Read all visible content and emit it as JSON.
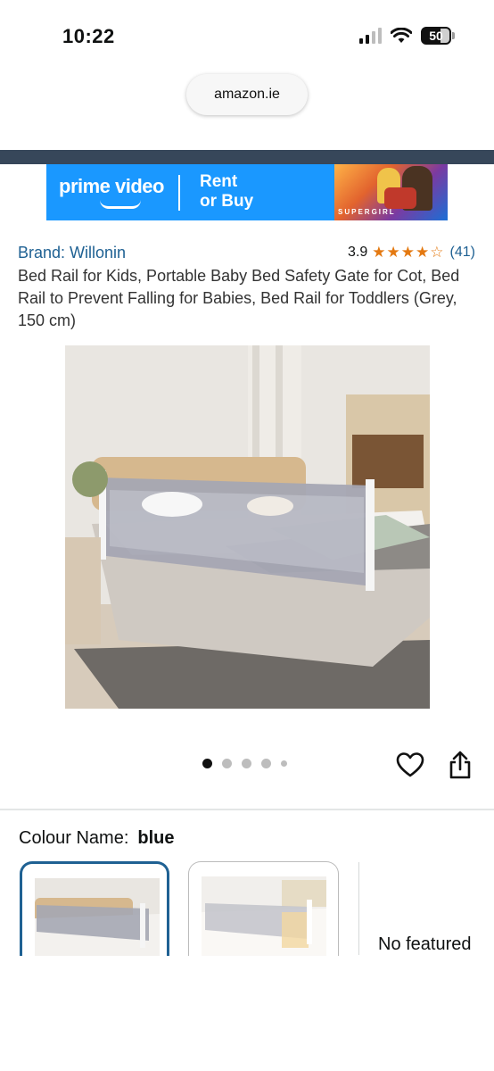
{
  "status_bar": {
    "time": "10:22",
    "battery": "50",
    "icons": [
      "cellular-signal-icon",
      "wifi-icon",
      "battery-icon"
    ]
  },
  "browser": {
    "url": "amazon.ie"
  },
  "banner": {
    "logo": "prime video",
    "cta_line1": "Rent",
    "cta_line2": "or Buy",
    "art_label": "SUPERGIRL"
  },
  "product": {
    "brand": "Brand: Willonin",
    "rating": "3.9",
    "stars": 3.9,
    "review_count": "(41)",
    "title": "Bed Rail for Kids, Portable Baby Bed Safety Gate for Cot, Bed Rail to Prevent Falling for Babies, Bed Rail for Toddlers (Grey, 150 cm)"
  },
  "carousel": {
    "dots": 5,
    "active_index": 0
  },
  "actions": {
    "wishlist_icon": "heart-icon",
    "share_icon": "share-icon"
  },
  "variant": {
    "label": "Colour Name:",
    "value": "blue",
    "no_featured": "No featured"
  },
  "colors": {
    "link": "#1f6193",
    "star": "#e47911",
    "prime_blue": "#1a98ff",
    "header_band": "#37475a"
  }
}
